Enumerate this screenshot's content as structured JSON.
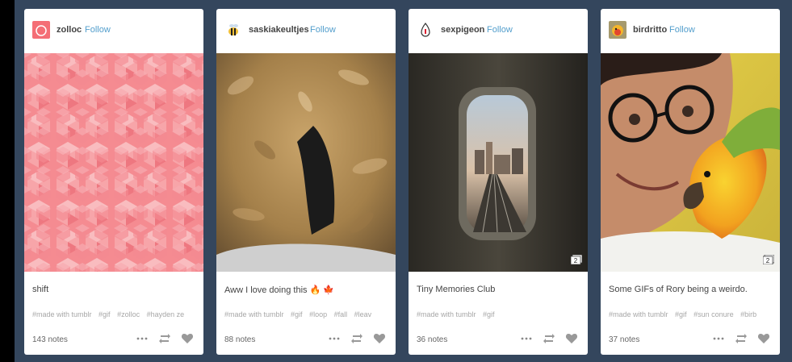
{
  "posts": [
    {
      "username": "zolloc",
      "follow": "Follow",
      "caption": "shift",
      "tags": [
        "#made with tumblr",
        "#gif",
        "#zolloc",
        "#hayden ze"
      ],
      "notes": "143 notes",
      "avatar_icon": "pink-square-avatar",
      "accent": "#f46e76"
    },
    {
      "username": "saskiakeultjes",
      "follow": "Follow",
      "caption": "Aww I love doing this 🔥 🍁",
      "tags": [
        "#made with tumblr",
        "#gif",
        "#loop",
        "#fall",
        "#leav"
      ],
      "notes": "88 notes",
      "avatar_icon": "bee-avatar",
      "accent": "#b89259"
    },
    {
      "username": "sexpigeon",
      "follow": "Follow",
      "caption": "Tiny Memories Club",
      "tags": [
        "#made with tumblr",
        "#gif"
      ],
      "notes": "36 notes",
      "avatar_icon": "red-drop-avatar",
      "badge": "2",
      "accent": "#3a3730"
    },
    {
      "username": "birdritto",
      "follow": "Follow",
      "caption": "Some GIFs of Rory being a weirdo.",
      "tags": [
        "#made with tumblr",
        "#gif",
        "#sun conure",
        "#birb"
      ],
      "notes": "37 notes",
      "avatar_icon": "bird-avatar",
      "badge": "2",
      "accent": "#f7c92c"
    }
  ],
  "colors": {
    "background": "#34465d",
    "link": "#529ecc",
    "muted": "#a7a7a7"
  },
  "icons": [
    "more-icon",
    "reblog-icon",
    "like-icon"
  ]
}
